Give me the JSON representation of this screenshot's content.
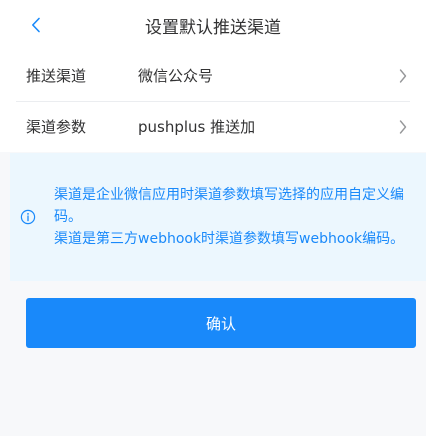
{
  "colors": {
    "primary": "#1989fa",
    "notice_bg": "#ecf7fe",
    "page_bg": "#f7f8fa",
    "arrow": "#969799"
  },
  "navbar": {
    "back_icon": "chevron-left-icon",
    "title": "设置默认推送渠道"
  },
  "cells": [
    {
      "title": "推送渠道",
      "value": "微信公众号",
      "icon": "chevron-right-icon"
    },
    {
      "title": "渠道参数",
      "value": "pushplus 推送加",
      "icon": "chevron-right-icon"
    }
  ],
  "notice": {
    "icon": "info-circle-icon",
    "lines": [
      "渠道是企业微信应用时渠道参数填写选择的应用自定义编码。",
      "渠道是第三方webhook时渠道参数填写webhook编码。"
    ]
  },
  "confirm_button": {
    "label": "确认"
  }
}
